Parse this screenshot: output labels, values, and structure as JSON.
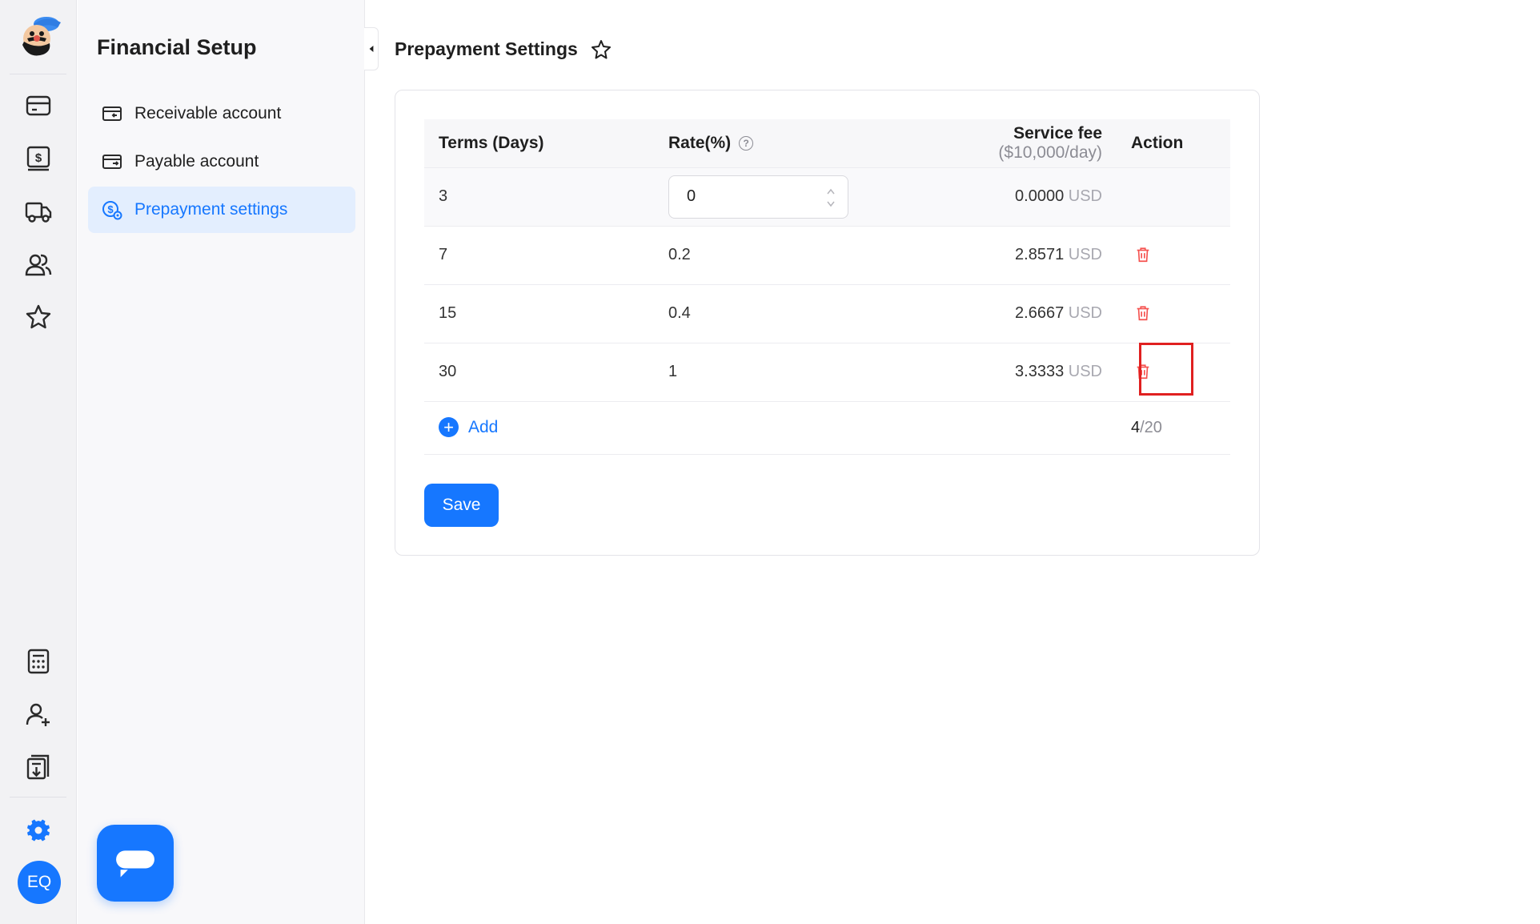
{
  "rail": {
    "items": [
      "card-icon",
      "dollar-bill-icon",
      "truck-icon",
      "users-icon",
      "star-icon"
    ],
    "bottom_items": [
      "calculator-icon",
      "add-user-icon",
      "download-list-icon",
      "settings-gear-icon"
    ],
    "avatar_initials": "EQ"
  },
  "sidebar": {
    "title": "Financial Setup",
    "items": [
      {
        "label": "Receivable account",
        "icon": "receivable-card-icon",
        "active": false
      },
      {
        "label": "Payable account",
        "icon": "payable-card-icon",
        "active": false
      },
      {
        "label": "Prepayment settings",
        "icon": "prepayment-dollar-icon",
        "active": true
      }
    ]
  },
  "page": {
    "title": "Prepayment Settings",
    "favorite_icon": "star-outline-icon"
  },
  "table": {
    "headers": {
      "terms": "Terms (Days)",
      "rate": "Rate(%)",
      "service_fee": "Service fee",
      "service_fee_unit": "($10,000/day)",
      "action": "Action"
    },
    "rows": [
      {
        "terms": "3",
        "rate": "0",
        "fee": "0.0000",
        "currency": "USD",
        "editable": true
      },
      {
        "terms": "7",
        "rate": "0.2",
        "fee": "2.8571",
        "currency": "USD"
      },
      {
        "terms": "15",
        "rate": "0.4",
        "fee": "2.6667",
        "currency": "USD"
      },
      {
        "terms": "30",
        "rate": "1",
        "fee": "3.3333",
        "currency": "USD"
      }
    ],
    "add_label": "Add",
    "count_current": "4",
    "count_total": "/20"
  },
  "actions": {
    "save_label": "Save"
  },
  "colors": {
    "primary": "#1677ff",
    "danger": "#f5524f",
    "highlight": "#e02020"
  }
}
